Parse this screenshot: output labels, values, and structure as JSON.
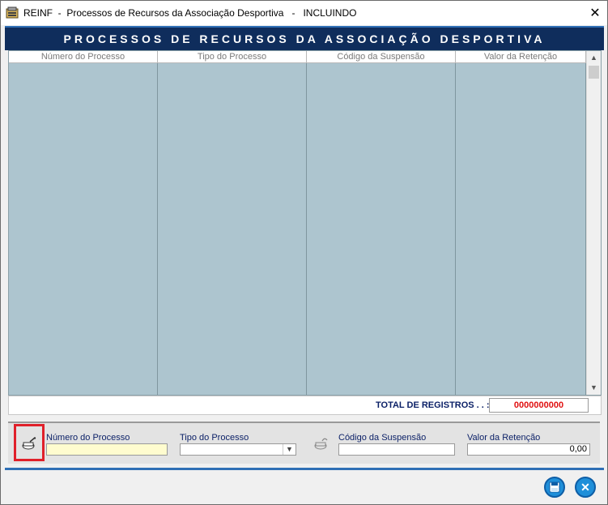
{
  "window": {
    "title": "REINF  -  Processos de Recursos da Associação Desportiva   -   INCLUINDO",
    "close_glyph": "✕"
  },
  "header": {
    "title": "PROCESSOS DE RECURSOS DA ASSOCIAÇÃO DESPORTIVA"
  },
  "grid": {
    "columns": [
      "Número do Processo",
      "Tipo do Processo",
      "Código da Suspensão",
      "Valor da Retenção"
    ],
    "rows": []
  },
  "footer": {
    "total_label": "TOTAL DE REGISTROS . . :",
    "total_value": "0000000000"
  },
  "form": {
    "numero_label": "Número do Processo",
    "numero_value": "",
    "tipo_label": "Tipo do Processo",
    "tipo_value": "",
    "codigo_label": "Código da Suspensão",
    "codigo_value": "",
    "valor_label": "Valor da Retenção",
    "valor_value": "0,00"
  },
  "icons": {
    "app": "database-icon",
    "edit": "edit-record-icon",
    "lookup": "lock-lookup-icon",
    "save": "save-icon",
    "cancel": "close-icon"
  },
  "colors": {
    "header_band": "#0f2d5c",
    "grid_bg": "#adc5cf",
    "total_value": "#e01010",
    "labels": "#0a1f66",
    "highlight_box": "#e0202a",
    "button": "#1f8fd9"
  }
}
